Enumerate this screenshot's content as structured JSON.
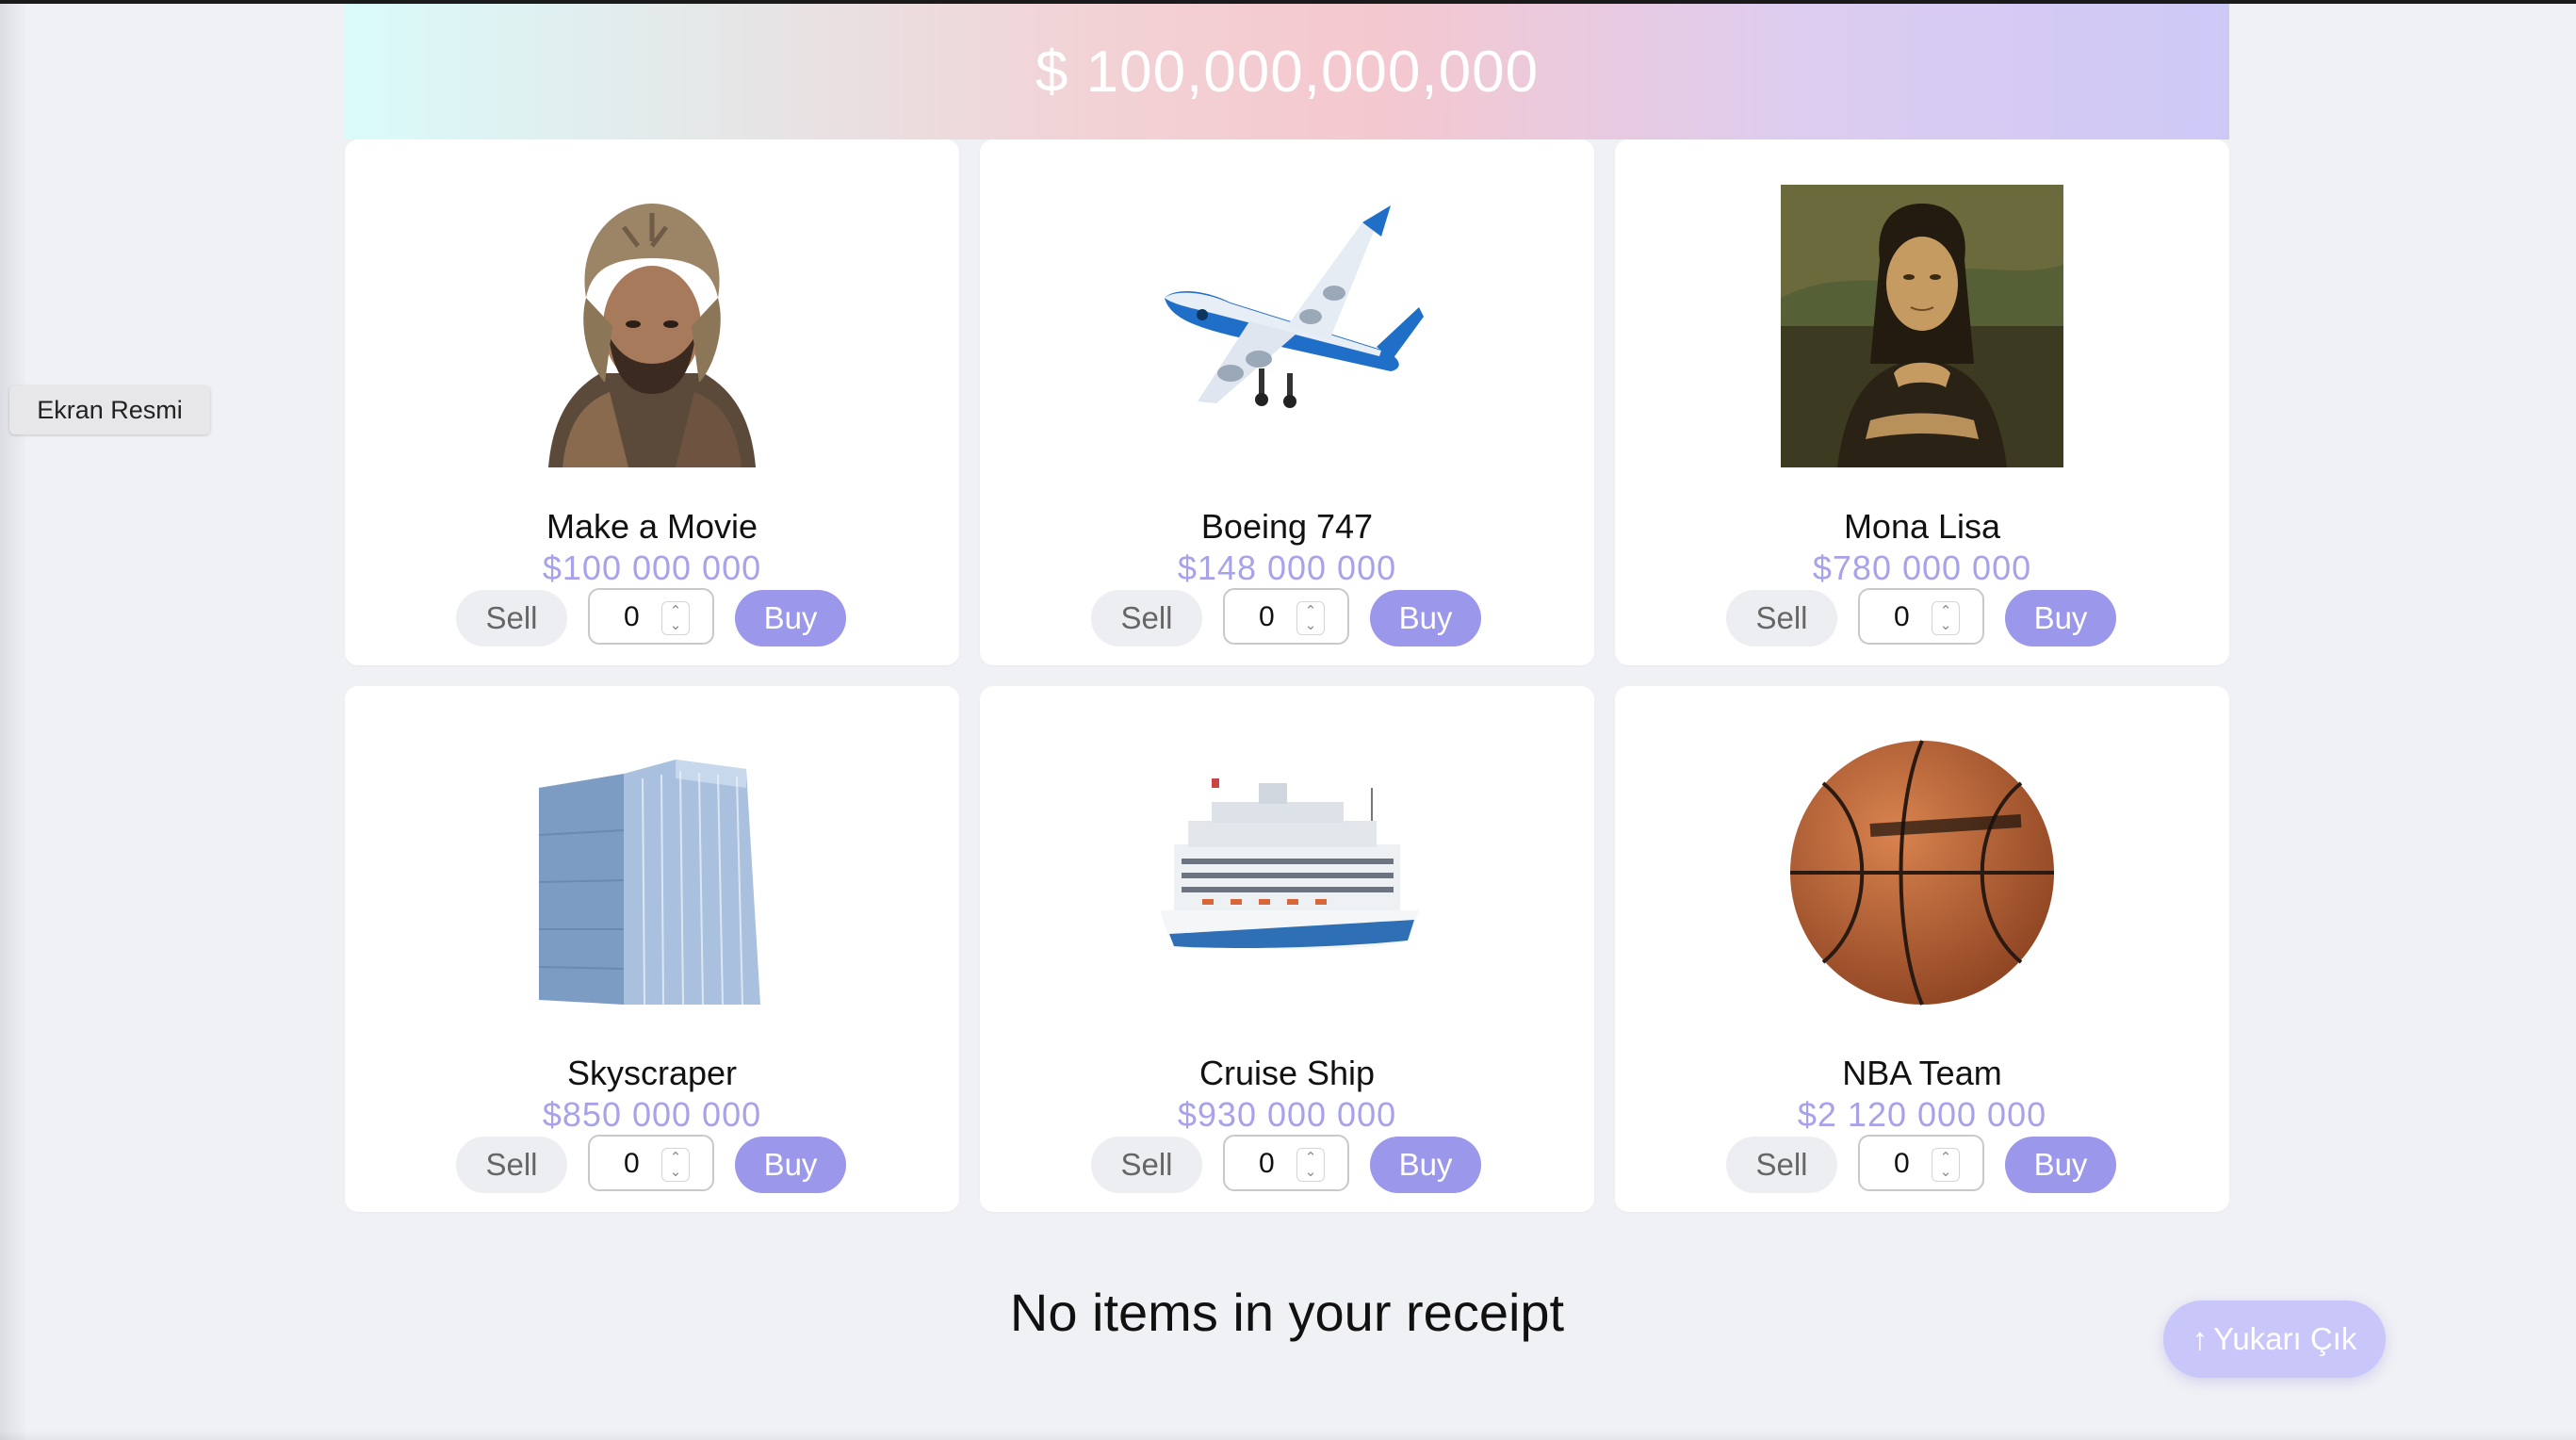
{
  "screenshot_button": {
    "label": "Ekran Resmi"
  },
  "balance": {
    "text": "$ 100,000,000,000"
  },
  "products": [
    {
      "name": "Make a Movie",
      "price": "$100 000 000",
      "quantity": "0",
      "sell_label": "Sell",
      "buy_label": "Buy",
      "image_icon": "actor-image"
    },
    {
      "name": "Boeing 747",
      "price": "$148 000 000",
      "quantity": "0",
      "sell_label": "Sell",
      "buy_label": "Buy",
      "image_icon": "airplane-image"
    },
    {
      "name": "Mona Lisa",
      "price": "$780 000 000",
      "quantity": "0",
      "sell_label": "Sell",
      "buy_label": "Buy",
      "image_icon": "painting-image"
    },
    {
      "name": "Skyscraper",
      "price": "$850 000 000",
      "quantity": "0",
      "sell_label": "Sell",
      "buy_label": "Buy",
      "image_icon": "building-image"
    },
    {
      "name": "Cruise Ship",
      "price": "$930 000 000",
      "quantity": "0",
      "sell_label": "Sell",
      "buy_label": "Buy",
      "image_icon": "ship-image"
    },
    {
      "name": "NBA Team",
      "price": "$2 120 000 000",
      "quantity": "0",
      "sell_label": "Sell",
      "buy_label": "Buy",
      "image_icon": "basketball-image"
    }
  ],
  "receipt": {
    "empty_text": "No items in your receipt"
  },
  "scroll_top_button": {
    "label": "Yukarı Çık"
  },
  "colors": {
    "accent": "#9b97ea",
    "price": "#a7a2ea",
    "background": "#f0f1f5"
  }
}
